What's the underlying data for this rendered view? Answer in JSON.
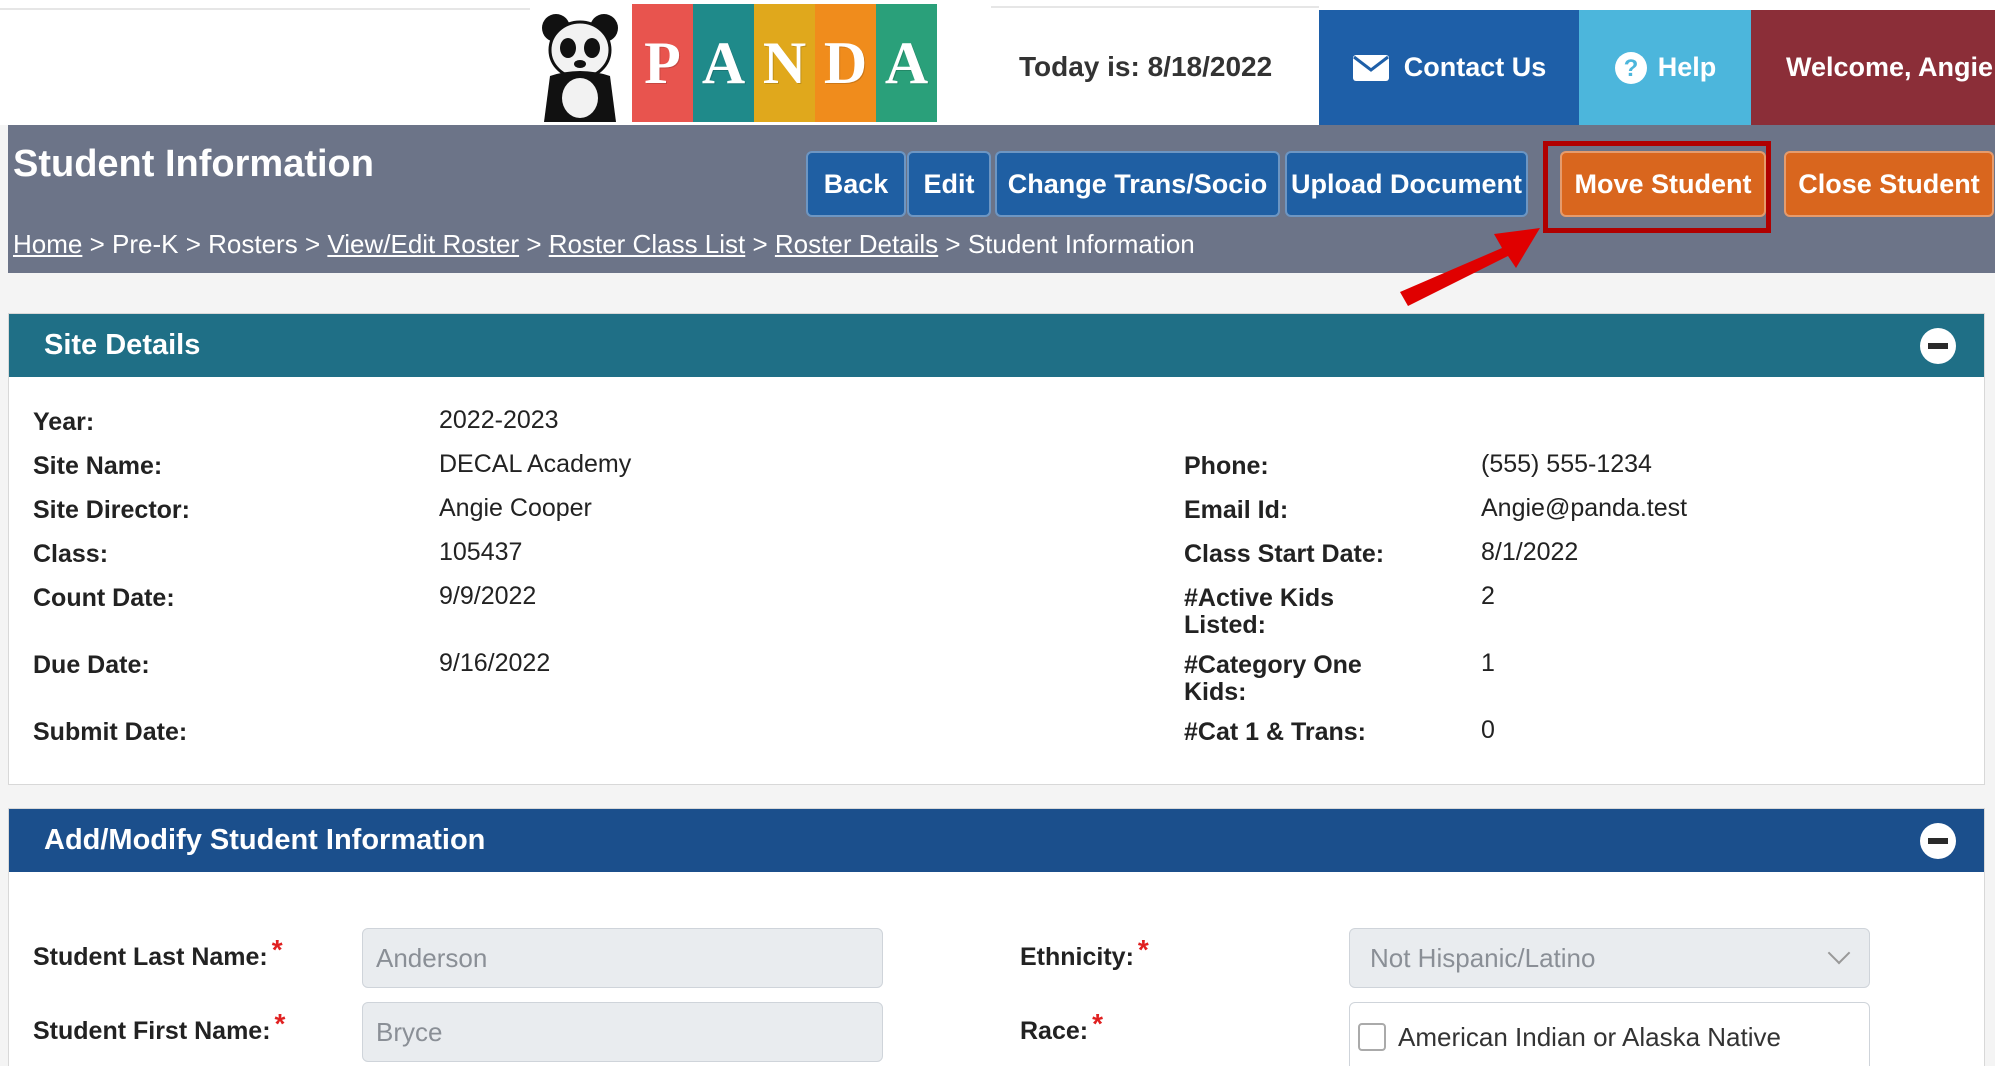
{
  "header": {
    "logo_letters": [
      "P",
      "A",
      "N",
      "D",
      "A"
    ],
    "logo_colors": [
      "#e8544e",
      "#1f8a8a",
      "#e0a81c",
      "#f08c1c",
      "#2aa07a"
    ],
    "today": "Today is: 8/18/2022",
    "contact": "Contact Us",
    "help": "Help",
    "welcome": "Welcome, Angie"
  },
  "page": {
    "title": "Student Information",
    "buttons": {
      "back": "Back",
      "edit": "Edit",
      "change": "Change Trans/Socio",
      "upload": "Upload Document",
      "move": "Move Student",
      "close": "Close Student"
    },
    "breadcrumb": {
      "home": "Home",
      "prek": "Pre-K",
      "rosters": "Rosters",
      "view_edit": "View/Edit Roster",
      "class_list": "Roster Class List",
      "details": "Roster Details",
      "current": "Student Information",
      "sep": ">"
    }
  },
  "site_details": {
    "title": "Site Details",
    "year_label": "Year:",
    "year": "2022-2023",
    "site_name_label": "Site Name:",
    "site_name": "DECAL Academy",
    "director_label": "Site Director:",
    "director": "Angie Cooper",
    "class_label": "Class:",
    "class": "105437",
    "count_date_label": "Count Date:",
    "count_date": "9/9/2022",
    "due_date_label": "Due Date:",
    "due_date": "9/16/2022",
    "submit_date_label": "Submit Date:",
    "phone_label": "Phone:",
    "phone": "(555) 555-1234",
    "email_label": "Email Id:",
    "email": "Angie@panda.test",
    "class_start_label": "Class Start Date:",
    "class_start": "8/1/2022",
    "active_kids_label_1": "#Active Kids",
    "active_kids_label_2": "Listed:",
    "active_kids": "2",
    "cat_one_label_1": "#Category One",
    "cat_one_label_2": "Kids:",
    "cat_one": "1",
    "cat1_trans_label": "#Cat 1 & Trans:",
    "cat1_trans": "0"
  },
  "student_info": {
    "title": "Add/Modify Student Information",
    "last_name_label": "Student Last Name:",
    "last_name": "Anderson",
    "first_name_label": "Student First Name:",
    "first_name": "Bryce",
    "ethnicity_label": "Ethnicity:",
    "ethnicity": "Not Hispanic/Latino",
    "race_label": "Race:",
    "race_option": "American Indian or Alaska Native",
    "required_mark": "*"
  }
}
